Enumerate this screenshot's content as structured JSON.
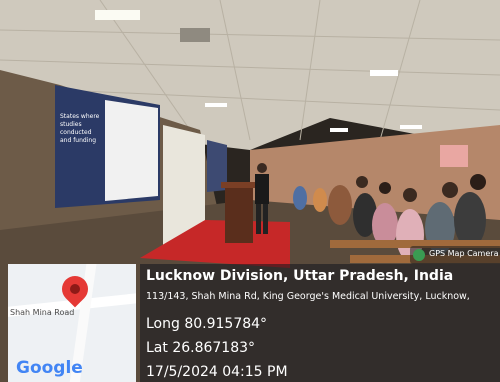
{
  "photo": {
    "screen_text": "States where studies conducted and funding"
  },
  "stamp": {
    "badge": "GPS Map Camera",
    "location": "Lucknow Division, Uttar Pradesh, India",
    "address": "113/143, Shah Mina Rd, King George's Medical University, Lucknow,",
    "longitude": "Long 80.915784°",
    "latitude": "Lat 26.867183°",
    "datetime": "17/5/2024 04:15 PM",
    "map_label": "Shah Mina Road",
    "map_brand": "Google"
  },
  "icons": {
    "pin": "location-pin-icon",
    "gps": "gps-camera-icon"
  },
  "colors": {
    "pin": "#e53935",
    "carpet": "#c62828",
    "wall": "#7a6a58"
  }
}
